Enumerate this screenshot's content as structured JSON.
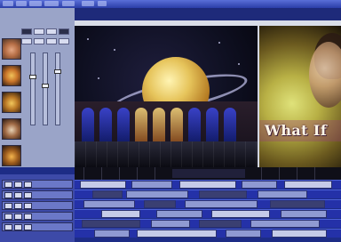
{
  "preview": {
    "title_text": "What If"
  },
  "colors": {
    "window_background": "#1e2a7a",
    "menubar": "#2b3ea8",
    "panel": "#9aa4c8",
    "timeline": "#1d2c86",
    "viewer_background": "#111111",
    "title_text": "#fff7e8"
  },
  "icons": {
    "planet_scene": "saturn-planet-illustration",
    "right_clip": "person-face-closeup"
  }
}
